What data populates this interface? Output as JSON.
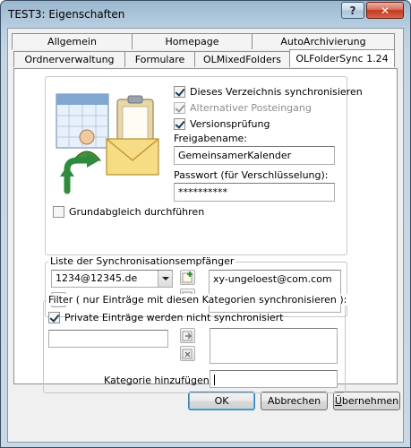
{
  "window": {
    "title": "TEST3: Eigenschaften",
    "help_label": "?",
    "close_label": "✕"
  },
  "tabs": {
    "row1": [
      {
        "label": "Allgemein"
      },
      {
        "label": "Homepage"
      },
      {
        "label": "AutoArchivierung"
      }
    ],
    "row2": [
      {
        "label": "Ordnerverwaltung"
      },
      {
        "label": "Formulare"
      },
      {
        "label": "OLMixedFolders"
      },
      {
        "label": "OLFolderSync 1.24",
        "active": true
      }
    ]
  },
  "sync": {
    "checkbox_sync_label": "Dieses Verzeichnis synchronisieren",
    "checkbox_sync_checked": true,
    "checkbox_alt_inbox_label": "Alternativer Posteingang",
    "checkbox_alt_inbox_checked": true,
    "checkbox_version_label": "Versionsprüfung",
    "checkbox_version_checked": true,
    "share_name_label": "Freigabename:",
    "share_name_value": "GemeinsamerKalender",
    "password_label": "Passwort (für Verschlüsselung):",
    "password_value": "**********",
    "baseline_label": "Grundabgleich durchführen",
    "baseline_checked": false
  },
  "recipients": {
    "group_label": "Liste der Synchronisationsempfänger",
    "combo_value": "1234@12345.de",
    "list_items": [
      "xy-ungeloest@com.com"
    ]
  },
  "filter": {
    "group_label": "Filter ( nur Einträge mit diesen Kategorien synchronisieren ):",
    "private_label": "Private Einträge werden nicht synchronisiert",
    "private_checked": true,
    "left_input_value": "",
    "add_category_label": "Kategorie hinzufügen:",
    "add_category_value": ""
  },
  "buttons": {
    "ok_label": "OK",
    "cancel_label": "Abbrechen",
    "apply_prefix": "",
    "apply_mnemonic": "Ü",
    "apply_rest": "bernehmen"
  },
  "colors": {
    "accent_border": "#3c7fb1",
    "title_gradient_top": "#9ab7cf",
    "close_red": "#c1391f"
  }
}
